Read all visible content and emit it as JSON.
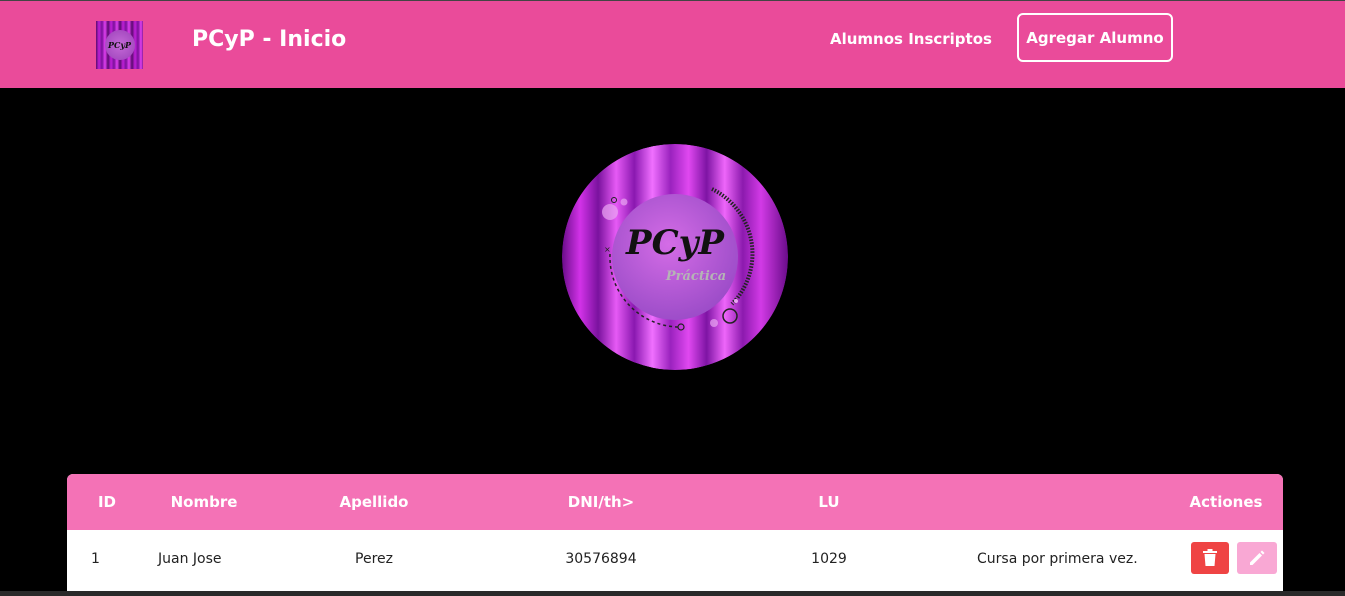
{
  "navbar": {
    "brand_logo_text": "PCyP",
    "title": "PCyP - Inicio",
    "link_label": "Alumnos Inscriptos",
    "button_label": "Agregar Alumno",
    "background_color": "#ea4b9a"
  },
  "hero": {
    "logo_title": "PCyP",
    "logo_subtitle": "Práctica"
  },
  "table": {
    "header_color": "#f472b6",
    "columns": [
      "ID",
      "Nombre",
      "Apellido",
      "DNI/th>",
      "LU",
      "Actiones"
    ],
    "rows": [
      {
        "id": "1",
        "nombre": "Juan Jose",
        "apellido": "Perez",
        "dni": "30576894",
        "lu": "1029",
        "nota": "Cursa por primera vez."
      }
    ],
    "actions": {
      "delete_icon": "trash-icon",
      "delete_color": "#ef4444",
      "edit_icon": "pencil-icon",
      "edit_color": "#f9a8d4"
    }
  }
}
